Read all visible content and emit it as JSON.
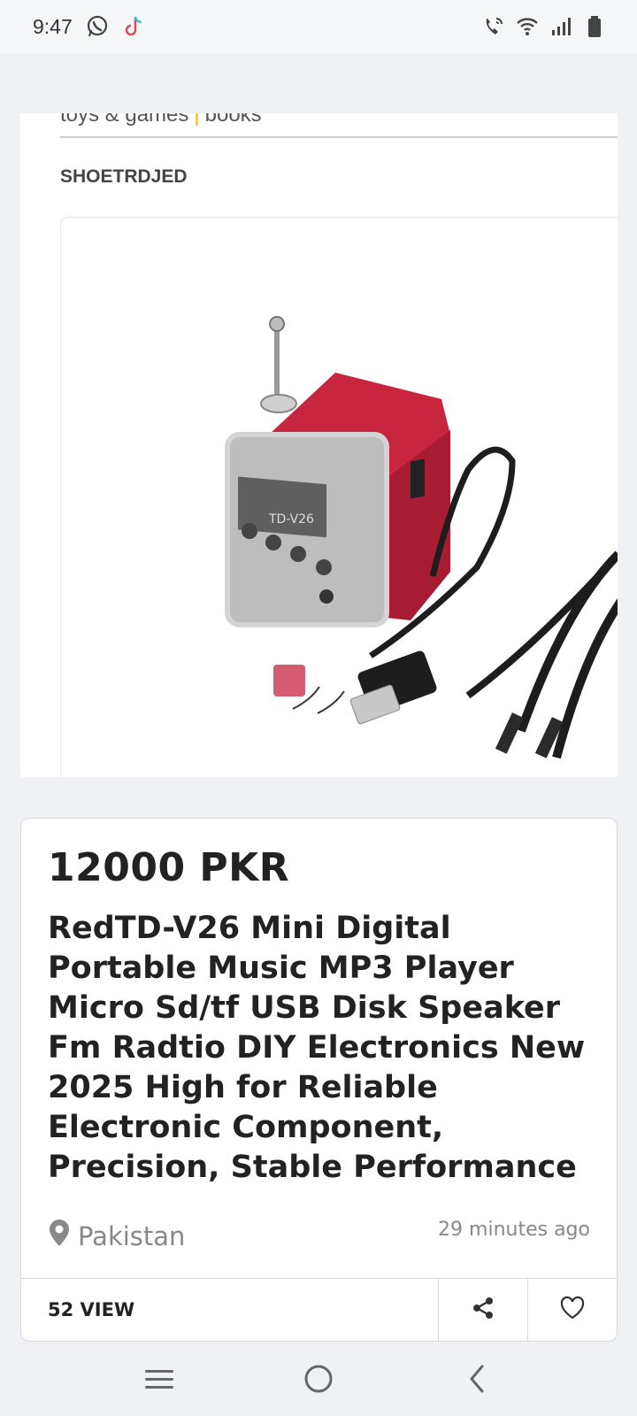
{
  "status_bar": {
    "time": "9:47",
    "left_icons": [
      "whatsapp-icon",
      "tiktok-icon"
    ],
    "right_icons": [
      "wifi-calling-icon",
      "wifi-icon",
      "signal-icon",
      "battery-icon"
    ]
  },
  "listing": {
    "category_left": "toys & games",
    "category_separator": "|",
    "category_right": "books",
    "brand": "SHOETRDJED",
    "price": "12000 PKR",
    "title": "RedTD-V26 Mini Digital Portable Music MP3 Player Micro Sd/tf USB Disk Speaker Fm Radtio DIY Electronics New 2025 High for Reliable Electronic Component, Precision, Stable Performance",
    "location": "Pakistan",
    "posted": "29 minutes ago",
    "views": "52 VIEW",
    "product_label": "TD-V26"
  },
  "nav_bar": {
    "icons": [
      "menu-icon",
      "home-icon",
      "back-icon"
    ]
  },
  "colors": {
    "accent_separator": "#f5b800",
    "speaker_red": "#c8263f",
    "background": "#f0f1f5"
  }
}
